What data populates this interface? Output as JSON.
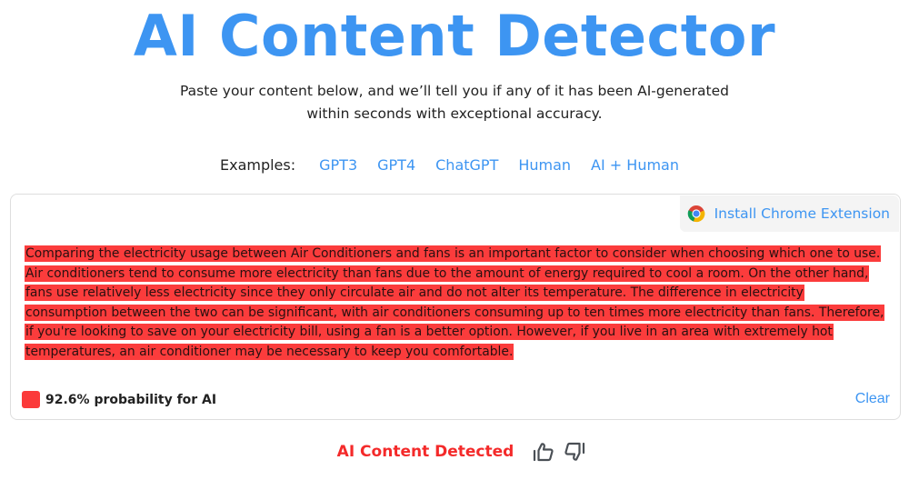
{
  "header": {
    "title": "AI Content Detector",
    "subtitle_line1": "Paste your content below, and we’ll tell you if any of it has been AI-generated",
    "subtitle_line2": "within seconds with exceptional accuracy."
  },
  "examples": {
    "label": "Examples:",
    "links": [
      "GPT3",
      "GPT4",
      "ChatGPT",
      "Human",
      "AI + Human"
    ]
  },
  "editor": {
    "extension_button": {
      "icon": "chrome-icon",
      "label": "Install Chrome Extension"
    },
    "content": "Comparing the electricity usage between Air Conditioners and fans is an important factor to consider when choosing which one to use. Air conditioners tend to consume more electricity than fans due to the amount of energy required to cool a room. On the other hand, fans use relatively less electricity since they only circulate air and do not alter its temperature. The difference in electricity consumption between the two can be significant, with air conditioners consuming up to ten times more electricity than fans. Therefore, if you're looking to save on your electricity bill, using a fan is a better option. However, if you live in an area with extremely hot temperatures, an air conditioner may be necessary to keep you comfortable.",
    "highlight_color": "#fb3c3c",
    "probability_label": "92.6% probability for AI",
    "probability_value": 92.6,
    "clear_label": "Clear"
  },
  "result": {
    "verdict": "AI Content Detected",
    "verdict_color": "#f42a2a",
    "feedback": [
      "thumbs-up-icon",
      "thumbs-down-icon"
    ]
  },
  "colors": {
    "accent": "#3d95f2",
    "ai_red": "#fb3a3a"
  }
}
